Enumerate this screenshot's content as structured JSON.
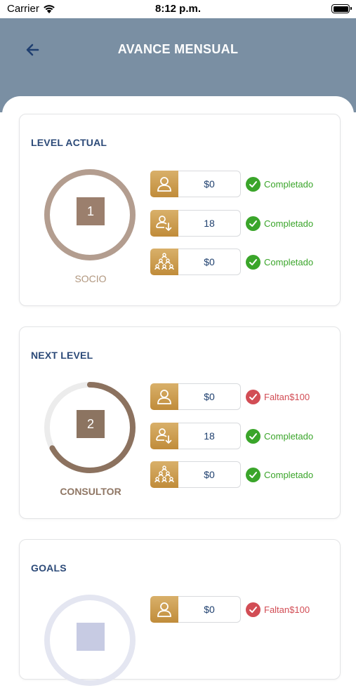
{
  "status_bar": {
    "carrier": "Carrier",
    "time": "8:12 p.m."
  },
  "header": {
    "title": "AVANCE MENSUAL",
    "back_icon": "arrow-left-icon"
  },
  "colors": {
    "header_bg": "#7a8fa3",
    "title_blue": "#2c4a78",
    "ring_brown": "#9e8371",
    "gold": "#c9983f",
    "ok_green": "#3aa52a",
    "missing_red": "#d24d55",
    "goals_lavender": "#c7cbe3"
  },
  "cards": [
    {
      "title": "LEVEL ACTUAL",
      "level_number": "1",
      "level_name": "SOCIO",
      "ring_progress": 1.0,
      "rows": [
        {
          "icon": "person-icon",
          "value": "$0",
          "status": "Completado",
          "state": "ok"
        },
        {
          "icon": "person-download-icon",
          "value": "18",
          "status": "Completado",
          "state": "ok"
        },
        {
          "icon": "team-pyramid-icon",
          "value": "$0",
          "status": "Completado",
          "state": "ok"
        }
      ]
    },
    {
      "title": "NEXT LEVEL",
      "level_number": "2",
      "level_name": "CONSULTOR",
      "ring_progress": 0.67,
      "rows": [
        {
          "icon": "person-icon",
          "value": "$0",
          "status": "Faltan$100",
          "state": "missing"
        },
        {
          "icon": "person-download-icon",
          "value": "18",
          "status": "Completado",
          "state": "ok"
        },
        {
          "icon": "team-pyramid-icon",
          "value": "$0",
          "status": "Completado",
          "state": "ok"
        }
      ]
    },
    {
      "title": "GOALS",
      "rows": [
        {
          "icon": "person-icon",
          "value": "$0",
          "status": "Faltan$100",
          "state": "missing"
        }
      ]
    }
  ]
}
